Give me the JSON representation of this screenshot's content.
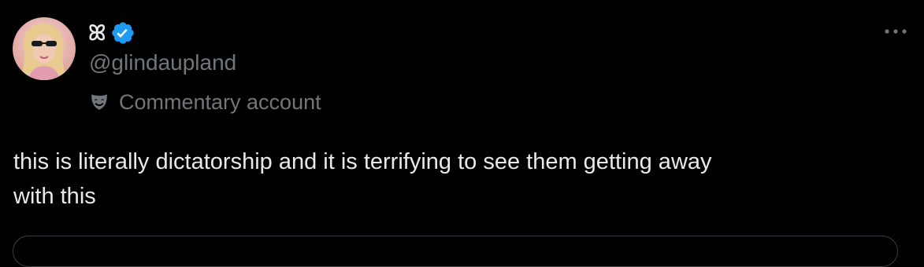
{
  "author": {
    "display_name": "ꕤ",
    "handle": "@glindaupland",
    "verified": true,
    "label": "Commentary account"
  },
  "tweet": {
    "text": "this is literally dictatorship and it is terrifying to see them getting away\nwith this"
  },
  "icons": {
    "verified": "verified-badge-icon",
    "label": "mask-icon",
    "more": "more-options-icon"
  },
  "colors": {
    "background": "#000000",
    "text_primary": "#e7e9ea",
    "text_secondary": "#71767b",
    "verified_blue": "#1d9bf0",
    "card_border": "#3a3d41"
  }
}
